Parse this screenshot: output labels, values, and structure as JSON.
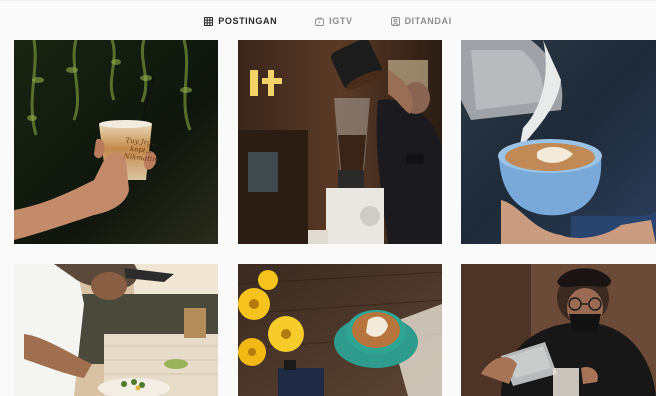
{
  "tabs": [
    {
      "label": "POSTINGAN",
      "icon": "grid-icon",
      "active": true
    },
    {
      "label": "IGTV",
      "icon": "igtv-icon",
      "active": false
    },
    {
      "label": "DITANDAI",
      "icon": "tagged-icon",
      "active": false
    }
  ],
  "posts": {
    "count_visible": 6,
    "post1_cup_text": "Tuy Jrg... kopi... Nikmatin"
  },
  "colors": {
    "active_tab": "#262626",
    "inactive_tab": "#8e8e8e",
    "background": "#fafafa"
  }
}
